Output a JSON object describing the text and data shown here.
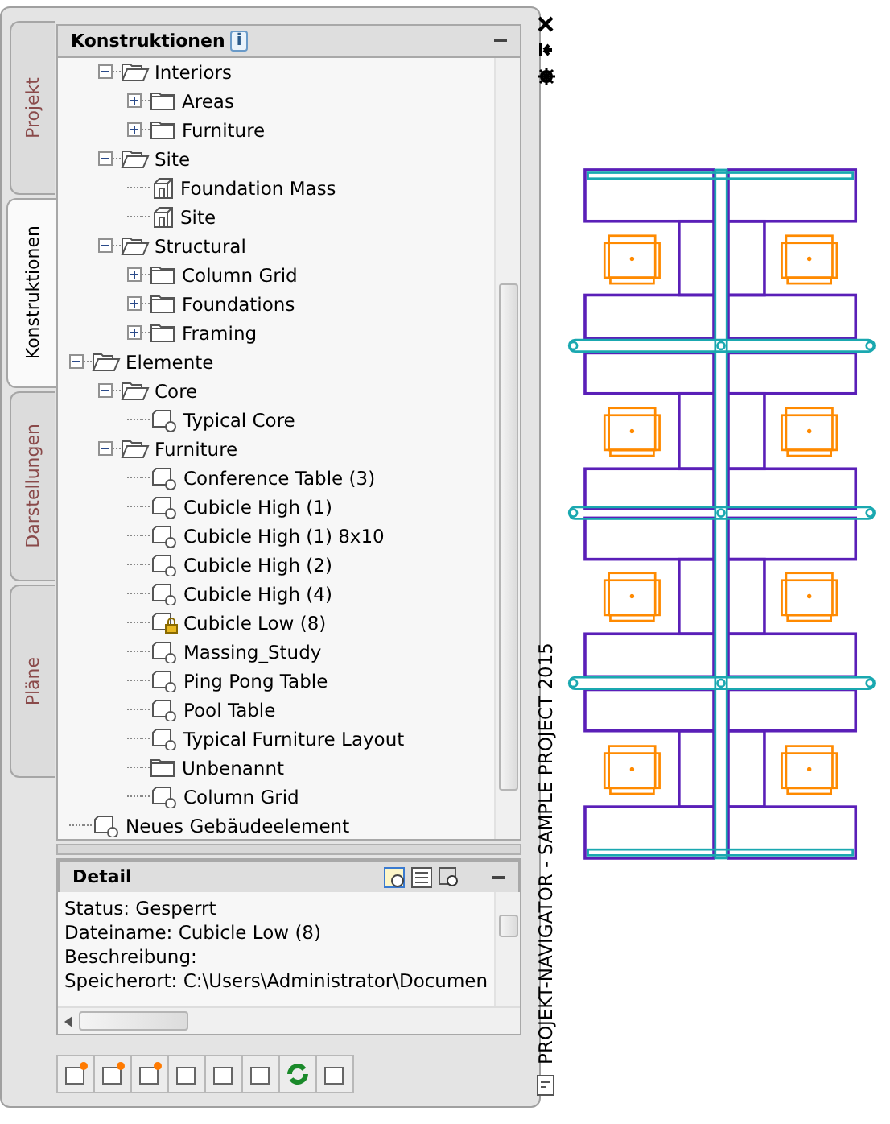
{
  "tabs": [
    {
      "label": "Projekt",
      "selected": false
    },
    {
      "label": "Konstruktionen",
      "selected": true
    },
    {
      "label": "Darstellungen",
      "selected": false
    },
    {
      "label": "Pläne",
      "selected": false
    }
  ],
  "tree_panel": {
    "title": "Konstruktionen",
    "info": "i"
  },
  "tree": {
    "continued_children": [
      {
        "label": "Interiors",
        "kind": "folder",
        "expanded": true,
        "children": [
          {
            "label": "Areas",
            "kind": "folder",
            "expanded": false
          },
          {
            "label": "Furniture",
            "kind": "folder",
            "expanded": false
          }
        ]
      },
      {
        "label": "Site",
        "kind": "folder",
        "expanded": true,
        "children": [
          {
            "label": "Foundation Mass",
            "kind": "construct"
          },
          {
            "label": "Site",
            "kind": "construct"
          }
        ]
      },
      {
        "label": "Structural",
        "kind": "folder",
        "expanded": true,
        "children": [
          {
            "label": "Column Grid",
            "kind": "folder",
            "expanded": false
          },
          {
            "label": "Foundations",
            "kind": "folder",
            "expanded": false
          },
          {
            "label": "Framing",
            "kind": "folder",
            "expanded": false
          }
        ]
      }
    ],
    "items": [
      {
        "label": "Elemente",
        "kind": "folder",
        "expanded": true,
        "children": [
          {
            "label": "Core",
            "kind": "folder",
            "expanded": true,
            "children": [
              {
                "label": "Typical Core",
                "kind": "element"
              }
            ]
          },
          {
            "label": "Furniture",
            "kind": "folder",
            "expanded": true,
            "children": [
              {
                "label": "Conference Table (3)",
                "kind": "element"
              },
              {
                "label": "Cubicle High (1)",
                "kind": "element"
              },
              {
                "label": "Cubicle High (1) 8x10",
                "kind": "element"
              },
              {
                "label": "Cubicle High (2)",
                "kind": "element"
              },
              {
                "label": "Cubicle High (4)",
                "kind": "element"
              },
              {
                "label": "Cubicle Low (8)",
                "kind": "locked-element"
              },
              {
                "label": "Massing_Study",
                "kind": "element"
              },
              {
                "label": "Ping Pong Table",
                "kind": "element"
              },
              {
                "label": "Pool Table",
                "kind": "element"
              },
              {
                "label": "Typical Furniture Layout",
                "kind": "element"
              },
              {
                "label": "Unbenannt",
                "kind": "folder"
              },
              {
                "label": "Column Grid",
                "kind": "element"
              }
            ]
          }
        ]
      },
      {
        "label": "Neues Gebäudeelement",
        "kind": "element"
      }
    ]
  },
  "detail": {
    "title": "Detail",
    "lines": [
      "Status: Gesperrt",
      "Dateiname: Cubicle Low (8)",
      "Beschreibung:",
      "Speicherort: C:\\Users\\Administrator\\Documen"
    ]
  },
  "side_title": "PROJEKT-NAVIGATOR - SAMPLE PROJECT 2015"
}
